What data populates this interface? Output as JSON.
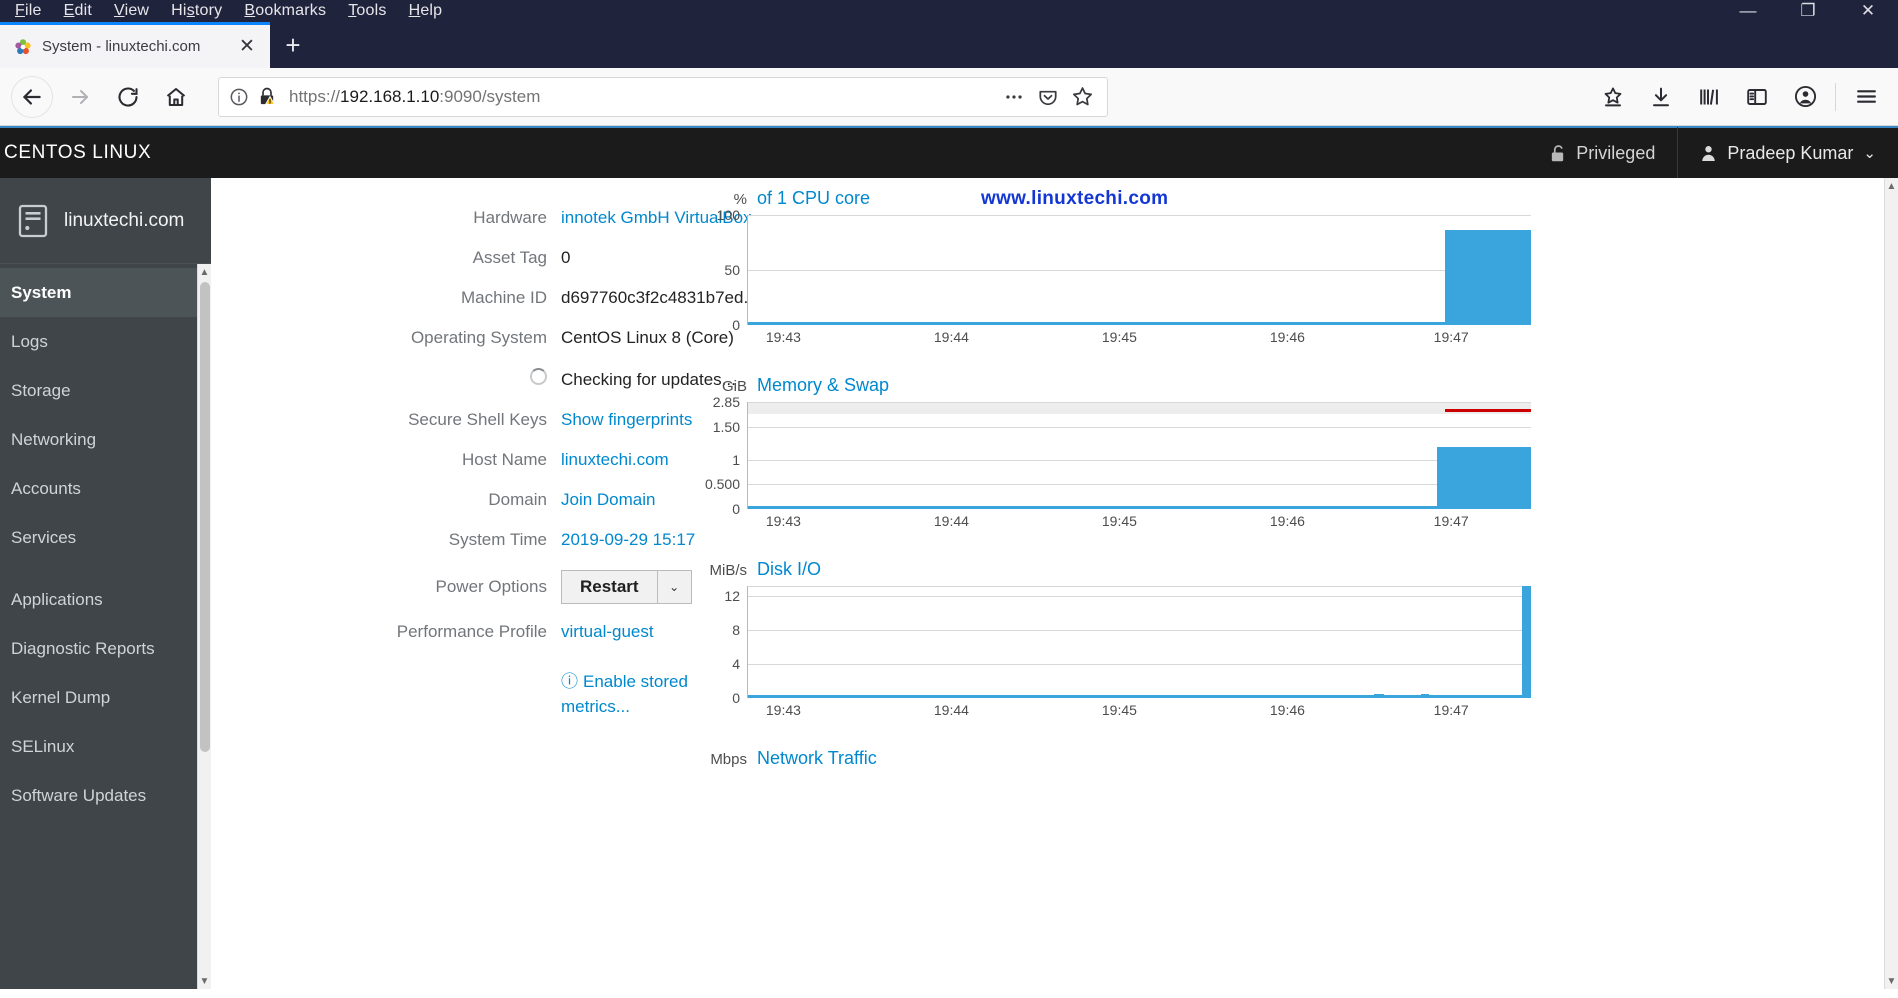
{
  "browser": {
    "menus": [
      "File",
      "Edit",
      "View",
      "History",
      "Bookmarks",
      "Tools",
      "Help"
    ],
    "window_controls": {
      "minimize": "—",
      "maximize": "❐",
      "close": "✕"
    },
    "tab": {
      "title": "System - linuxtechi.com",
      "close_label": "✕"
    },
    "new_tab_label": "+",
    "nav": {
      "back": "←",
      "forward": "→",
      "reload": "↻",
      "home": "⌂"
    },
    "url": {
      "scheme": "https://",
      "host": "192.168.1.10",
      "rest": ":9090/system",
      "full": "https://192.168.1.10:9090/system"
    },
    "urlbar_buttons": [
      "page-actions-icon",
      "pocket-icon",
      "bookmark-star-icon"
    ],
    "toolbar_buttons": [
      "screenshot-icon",
      "downloads-icon",
      "library-icon",
      "sidebar-icon",
      "account-icon",
      "menu-icon"
    ]
  },
  "cockpit": {
    "brand": "CENTOS LINUX",
    "privileged_label": "Privileged",
    "user_label": "Pradeep Kumar",
    "user_caret": "⌄",
    "sidebar": {
      "host": "linuxtechi.com",
      "items": [
        {
          "label": "System",
          "active": true
        },
        {
          "label": "Logs",
          "active": false
        },
        {
          "label": "Storage",
          "active": false
        },
        {
          "label": "Networking",
          "active": false
        },
        {
          "label": "Accounts",
          "active": false
        },
        {
          "label": "Services",
          "active": false
        }
      ],
      "items2": [
        {
          "label": "Applications",
          "active": false
        },
        {
          "label": "Diagnostic Reports",
          "active": false
        },
        {
          "label": "Kernel Dump",
          "active": false
        },
        {
          "label": "SELinux",
          "active": false
        },
        {
          "label": "Software Updates",
          "active": false
        }
      ]
    },
    "system_info": [
      {
        "label": "Hardware",
        "value": "innotek GmbH VirtualBox",
        "link": true
      },
      {
        "label": "Asset Tag",
        "value": "0",
        "link": false
      },
      {
        "label": "Machine ID",
        "value": "d697760c3f2c4831b7ed...",
        "link": false
      },
      {
        "label": "Operating System",
        "value": "CentOS Linux 8 (Core)",
        "link": false
      },
      {
        "label": "",
        "value": "Checking for updates...",
        "link": false,
        "spinner": true
      },
      {
        "label": "Secure Shell Keys",
        "value": "Show fingerprints",
        "link": true
      },
      {
        "label": "Host Name",
        "value": "linuxtechi.com",
        "link": true
      },
      {
        "label": "Domain",
        "value": "Join Domain",
        "link": true
      },
      {
        "label": "System Time",
        "value": "2019-09-29 15:17",
        "link": true
      }
    ],
    "power_options": {
      "label": "Power Options",
      "button": "Restart",
      "caret": "⌄"
    },
    "performance_profile": {
      "label": "Performance Profile",
      "value": "virtual-guest"
    },
    "enable_metrics": {
      "icon": "ⓘ",
      "line1": "Enable stored",
      "line2": "metrics..."
    },
    "watermark": "www.linuxtechi.com"
  },
  "chart_data": [
    {
      "type": "area",
      "title": "of 1 CPU core",
      "ylabel": "%",
      "yticks": [
        "100",
        "50",
        "0"
      ],
      "ylim": [
        0,
        100
      ],
      "xticks": [
        "19:43",
        "19:44",
        "19:45",
        "19:46",
        "19:47"
      ],
      "grid": true,
      "series": [
        {
          "name": "CPU",
          "color": "#39a5dc",
          "note": "flat near 0 until ~19:46:50 then jumps to ~90-95%"
        }
      ],
      "spike_start_pct": 89,
      "spike_value_pct": 93
    },
    {
      "type": "area",
      "title": "Memory & Swap",
      "ylabel": "GiB",
      "yticks": [
        "2.85",
        "1.50",
        "1",
        "0.500",
        "0"
      ],
      "ylim": [
        0,
        2.85
      ],
      "xticks": [
        "19:43",
        "19:44",
        "19:45",
        "19:46",
        "19:47"
      ],
      "grid": true,
      "series": [
        {
          "name": "Memory",
          "color": "#39a5dc",
          "note": "flat near 0 until ~19:46:45 then rises to ~1.2 GiB"
        },
        {
          "name": "Swap",
          "color": "#cc0000",
          "note": "red line at ~2.7 GiB on right edge"
        }
      ],
      "spike_start_pct": 88,
      "spike_value": 1.2
    },
    {
      "type": "area",
      "title": "Disk I/O",
      "ylabel": "MiB/s",
      "yticks": [
        "12",
        "8",
        "4",
        "0"
      ],
      "ylim": [
        0,
        13
      ],
      "xticks": [
        "19:43",
        "19:44",
        "19:45",
        "19:46",
        "19:47"
      ],
      "grid": true,
      "series": [
        {
          "name": "Disk I/O",
          "color": "#39a5dc",
          "note": "flat at 0 with a tall narrow spike to ~13 MiB/s at right edge"
        }
      ],
      "spike_start_pct": 98,
      "spike_value": 13
    },
    {
      "type": "area",
      "title": "Network Traffic",
      "ylabel": "Mbps",
      "yticks": [],
      "xticks": [],
      "grid": true,
      "series": []
    }
  ]
}
